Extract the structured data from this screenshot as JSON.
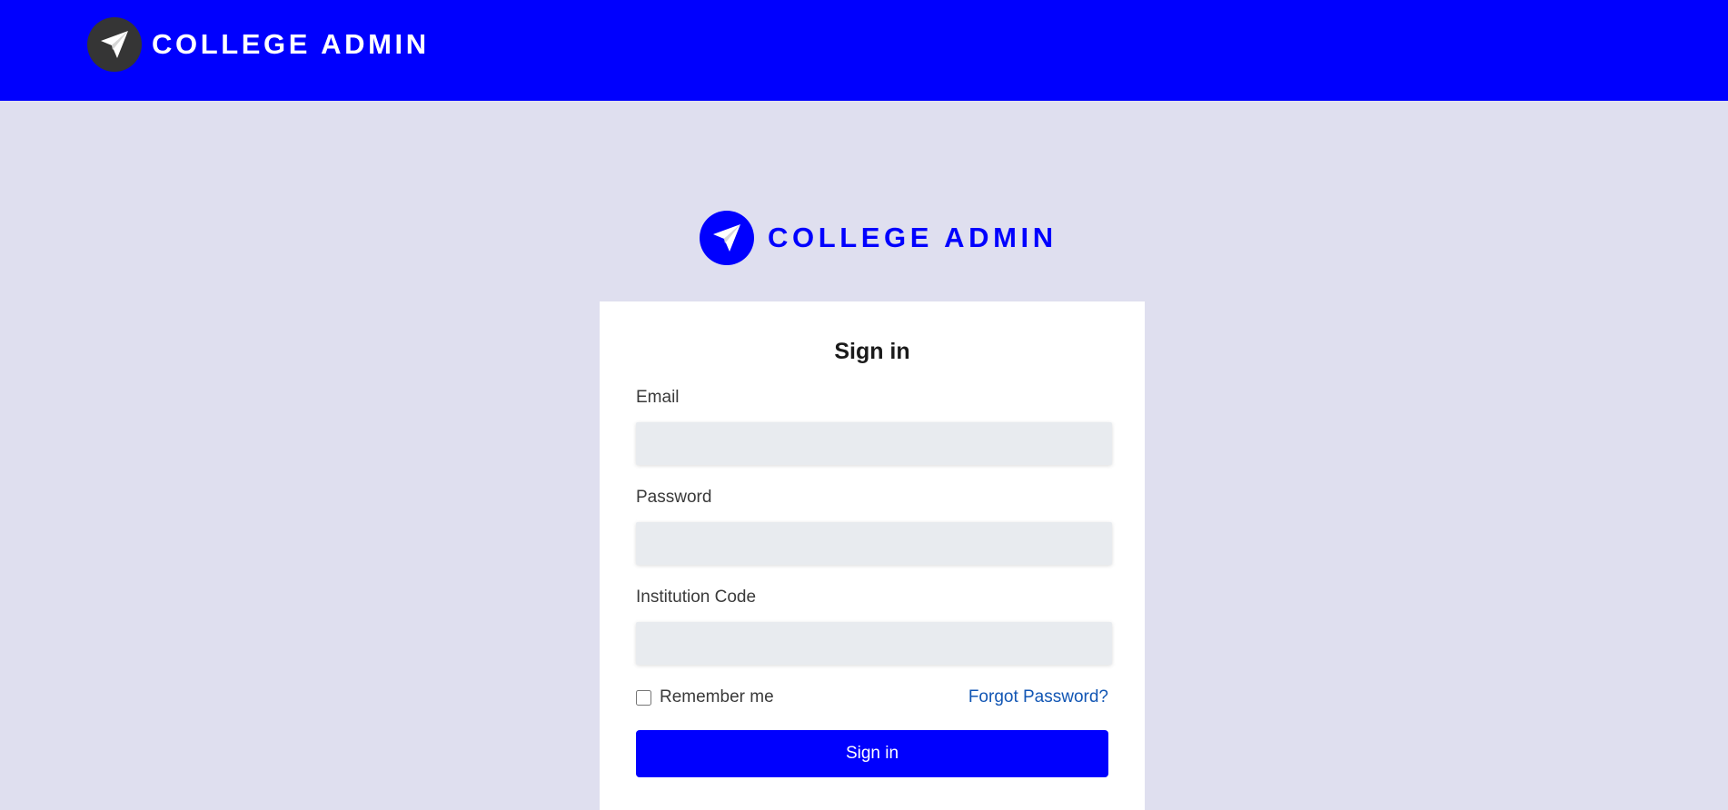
{
  "header": {
    "brand_title": "COLLEGE ADMIN",
    "logo_icon": "paper-plane-icon",
    "background_color": "#0000fe"
  },
  "login": {
    "brand_title": "COLLEGE ADMIN",
    "logo_icon": "paper-plane-icon",
    "card_title": "Sign in",
    "email_label": "Email",
    "email_value": "",
    "password_label": "Password",
    "password_value": "",
    "institution_label": "Institution Code",
    "institution_value": "",
    "remember_label": "Remember me",
    "remember_checked": false,
    "forgot_label": "Forgot Password?",
    "submit_label": "Sign in"
  },
  "colors": {
    "brand_blue": "#0000fe",
    "page_background": "#dfdfef",
    "link_blue": "#1256b4",
    "input_background": "#e8ebef"
  }
}
